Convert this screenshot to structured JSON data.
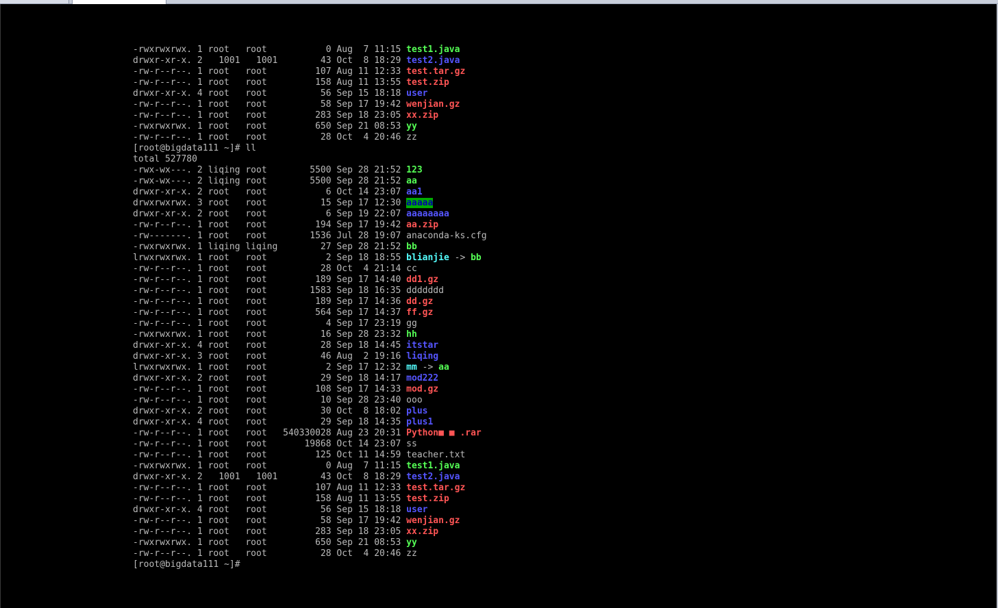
{
  "window": {
    "tabs": [
      "",
      ""
    ]
  },
  "colors": {
    "background": "#000000",
    "text": "#bbbbbb",
    "executable": "#55ff55",
    "directory": "#5555ff",
    "archive": "#ff5555",
    "symlink": "#55ffff",
    "sticky_bg": "#00aa00",
    "sticky_fg": "#0000aa"
  },
  "terminal": {
    "lines": [
      {
        "kind": "entry",
        "meta": "-rwxrwxrwx. 1 root   root           0 Aug  7 11:15 ",
        "name": "test1.java",
        "style": "exec"
      },
      {
        "kind": "entry",
        "meta": "drwxr-xr-x. 2   1001   1001        43 Oct  8 18:29 ",
        "name": "test2.java",
        "style": "dir"
      },
      {
        "kind": "entry",
        "meta": "-rw-r--r--. 1 root   root         107 Aug 11 12:33 ",
        "name": "test.tar.gz",
        "style": "arch"
      },
      {
        "kind": "entry",
        "meta": "-rw-r--r--. 1 root   root         158 Aug 11 13:55 ",
        "name": "test.zip",
        "style": "arch"
      },
      {
        "kind": "entry",
        "meta": "drwxr-xr-x. 4 root   root          56 Sep 15 18:18 ",
        "name": "user",
        "style": "dir"
      },
      {
        "kind": "entry",
        "meta": "-rw-r--r--. 1 root   root          58 Sep 17 19:42 ",
        "name": "wenjian.gz",
        "style": "arch"
      },
      {
        "kind": "entry",
        "meta": "-rw-r--r--. 1 root   root         283 Sep 18 23:05 ",
        "name": "xx.zip",
        "style": "arch"
      },
      {
        "kind": "entry",
        "meta": "-rwxrwxrwx. 1 root   root         650 Sep 21 08:53 ",
        "name": "yy",
        "style": "exec"
      },
      {
        "kind": "entry",
        "meta": "-rw-r--r--. 1 root   root          28 Oct  4 20:46 ",
        "name": "zz",
        "style": "plain"
      },
      {
        "kind": "text",
        "text": "[root@bigdata111 ~]# ll"
      },
      {
        "kind": "text",
        "text": "total 527780"
      },
      {
        "kind": "entry",
        "meta": "-rwx-wx---. 2 liqing root        5500 Sep 28 21:52 ",
        "name": "123",
        "style": "exec"
      },
      {
        "kind": "entry",
        "meta": "-rwx-wx---. 2 liqing root        5500 Sep 28 21:52 ",
        "name": "aa",
        "style": "exec"
      },
      {
        "kind": "entry",
        "meta": "drwxr-xr-x. 2 root   root           6 Oct 14 23:07 ",
        "name": "aa1",
        "style": "dir"
      },
      {
        "kind": "entry",
        "meta": "drwxrwxrwx. 3 root   root          15 Sep 17 12:30 ",
        "name": "aaaaa",
        "style": "sticky"
      },
      {
        "kind": "entry",
        "meta": "drwxr-xr-x. 2 root   root           6 Sep 19 22:07 ",
        "name": "aaaaaaaa",
        "style": "dir"
      },
      {
        "kind": "entry",
        "meta": "-rw-r--r--. 1 root   root         194 Sep 17 19:42 ",
        "name": "aa.zip",
        "style": "arch"
      },
      {
        "kind": "entry",
        "meta": "-rw-------. 1 root   root        1536 Jul 28 19:07 ",
        "name": "anaconda-ks.cfg",
        "style": "plain"
      },
      {
        "kind": "entry",
        "meta": "-rwxrwxrwx. 1 liqing liqing        27 Sep 28 21:52 ",
        "name": "bb",
        "style": "exec"
      },
      {
        "kind": "link",
        "meta": "lrwxrwxrwx. 1 root   root           2 Sep 18 18:55 ",
        "name": "blianjie",
        "arrow": " -> ",
        "target": "bb",
        "target_style": "exec"
      },
      {
        "kind": "entry",
        "meta": "-rw-r--r--. 1 root   root          28 Oct  4 21:14 ",
        "name": "cc",
        "style": "plain"
      },
      {
        "kind": "entry",
        "meta": "-rw-r--r--. 1 root   root         189 Sep 17 14:40 ",
        "name": "dd1.gz",
        "style": "arch"
      },
      {
        "kind": "entry",
        "meta": "-rw-r--r--. 1 root   root        1583 Sep 18 16:35 ",
        "name": "ddddddd",
        "style": "plain"
      },
      {
        "kind": "entry",
        "meta": "-rw-r--r--. 1 root   root         189 Sep 17 14:36 ",
        "name": "dd.gz",
        "style": "arch"
      },
      {
        "kind": "entry",
        "meta": "-rw-r--r--. 1 root   root         564 Sep 17 14:37 ",
        "name": "ff.gz",
        "style": "arch"
      },
      {
        "kind": "entry",
        "meta": "-rw-r--r--. 1 root   root           4 Sep 17 23:19 ",
        "name": "gg",
        "style": "plain"
      },
      {
        "kind": "entry",
        "meta": "-rwxrwxrwx. 1 root   root          16 Sep 28 23:32 ",
        "name": "hh",
        "style": "exec"
      },
      {
        "kind": "entry",
        "meta": "drwxr-xr-x. 4 root   root          28 Sep 18 14:45 ",
        "name": "itstar",
        "style": "dir"
      },
      {
        "kind": "entry",
        "meta": "drwxr-xr-x. 3 root   root          46 Aug  2 19:16 ",
        "name": "liqing",
        "style": "dir"
      },
      {
        "kind": "link",
        "meta": "lrwxrwxrwx. 1 root   root           2 Sep 17 12:32 ",
        "name": "mm",
        "arrow": " -> ",
        "target": "aa",
        "target_style": "exec"
      },
      {
        "kind": "entry",
        "meta": "drwxr-xr-x. 2 root   root          29 Sep 18 14:17 ",
        "name": "mod222",
        "style": "dir"
      },
      {
        "kind": "entry",
        "meta": "-rw-r--r--. 1 root   root         108 Sep 17 14:33 ",
        "name": "mod.gz",
        "style": "arch"
      },
      {
        "kind": "entry",
        "meta": "-rw-r--r--. 1 root   root          10 Sep 28 23:40 ",
        "name": "ooo",
        "style": "plain"
      },
      {
        "kind": "entry",
        "meta": "drwxr-xr-x. 2 root   root          30 Oct  8 18:02 ",
        "name": "plus",
        "style": "dir"
      },
      {
        "kind": "entry",
        "meta": "drwxr-xr-x. 4 root   root          29 Sep 18 14:35 ",
        "name": "plus1",
        "style": "dir"
      },
      {
        "kind": "entry",
        "meta": "-rw-r--r--. 1 root   root   540330028 Aug 23 20:31 ",
        "name": "Python■ ■ .rar",
        "style": "arch"
      },
      {
        "kind": "entry",
        "meta": "-rw-r--r--. 1 root   root       19868 Oct 14 23:07 ",
        "name": "ss",
        "style": "plain"
      },
      {
        "kind": "entry",
        "meta": "-rw-r--r--. 1 root   root         125 Oct 11 14:59 ",
        "name": "teacher.txt",
        "style": "plain"
      },
      {
        "kind": "entry",
        "meta": "-rwxrwxrwx. 1 root   root           0 Aug  7 11:15 ",
        "name": "test1.java",
        "style": "exec"
      },
      {
        "kind": "entry",
        "meta": "drwxr-xr-x. 2   1001   1001        43 Oct  8 18:29 ",
        "name": "test2.java",
        "style": "dir"
      },
      {
        "kind": "entry",
        "meta": "-rw-r--r--. 1 root   root         107 Aug 11 12:33 ",
        "name": "test.tar.gz",
        "style": "arch"
      },
      {
        "kind": "entry",
        "meta": "-rw-r--r--. 1 root   root         158 Aug 11 13:55 ",
        "name": "test.zip",
        "style": "arch"
      },
      {
        "kind": "entry",
        "meta": "drwxr-xr-x. 4 root   root          56 Sep 15 18:18 ",
        "name": "user",
        "style": "dir"
      },
      {
        "kind": "entry",
        "meta": "-rw-r--r--. 1 root   root          58 Sep 17 19:42 ",
        "name": "wenjian.gz",
        "style": "arch"
      },
      {
        "kind": "entry",
        "meta": "-rw-r--r--. 1 root   root         283 Sep 18 23:05 ",
        "name": "xx.zip",
        "style": "arch"
      },
      {
        "kind": "entry",
        "meta": "-rwxrwxrwx. 1 root   root         650 Sep 21 08:53 ",
        "name": "yy",
        "style": "exec"
      },
      {
        "kind": "entry",
        "meta": "-rw-r--r--. 1 root   root          28 Oct  4 20:46 ",
        "name": "zz",
        "style": "plain"
      },
      {
        "kind": "text",
        "text": "[root@bigdata111 ~]#"
      }
    ]
  }
}
